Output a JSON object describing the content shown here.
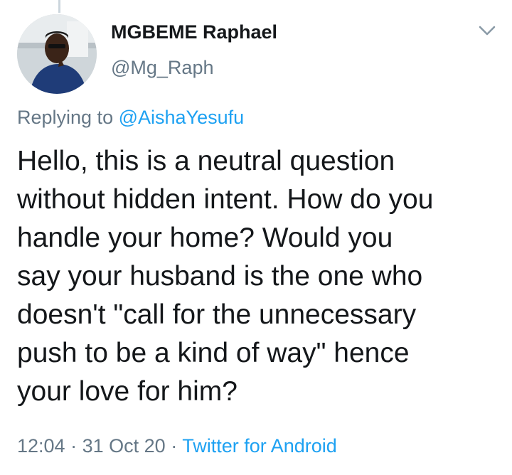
{
  "tweet": {
    "display_name": "MGBEME Raphael",
    "handle": "@Mg_Raph",
    "replying_to_label": "Replying to",
    "replying_to_handle": "@AishaYesufu",
    "text_lines": [
      "Hello, this is a neutral question",
      "without hidden intent. How do you",
      "handle your home? Would you",
      "say your husband is the one who",
      "doesn't \"call for the unnecessary",
      "push to be a kind of way\" hence",
      "your love for him?"
    ],
    "time": "12:04",
    "separator": "·",
    "date": "31 Oct 20",
    "source": "Twitter for Android"
  },
  "icons": {
    "menu": "chevron-down-icon",
    "avatar": "profile-photo"
  },
  "colors": {
    "text": "#14171a",
    "secondary": "#657786",
    "link": "#1da1f2",
    "thread_line": "#ccd6dd"
  }
}
